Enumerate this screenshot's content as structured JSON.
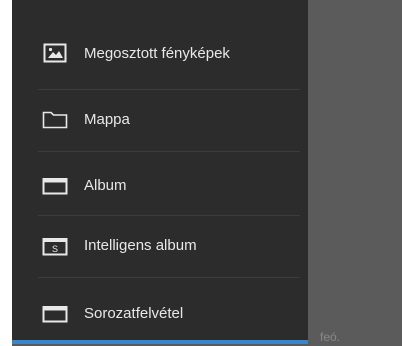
{
  "drawer": {
    "items": [
      {
        "label": "Megosztott fényképek",
        "icon": "image-icon"
      },
      {
        "label": "Mappa",
        "icon": "folder-icon"
      },
      {
        "label": "Album",
        "icon": "album-icon"
      },
      {
        "label": "Intelligens album",
        "icon": "smart-album-icon"
      },
      {
        "label": "Sorozatfelvétel",
        "icon": "burst-shot-icon"
      }
    ]
  },
  "background": {
    "partial_text": "feó."
  },
  "colors": {
    "drawer_bg": "#2c2c2c",
    "scrim": "#5b5b5b",
    "text": "#e8e8e8",
    "accent": "#3a86c8"
  }
}
